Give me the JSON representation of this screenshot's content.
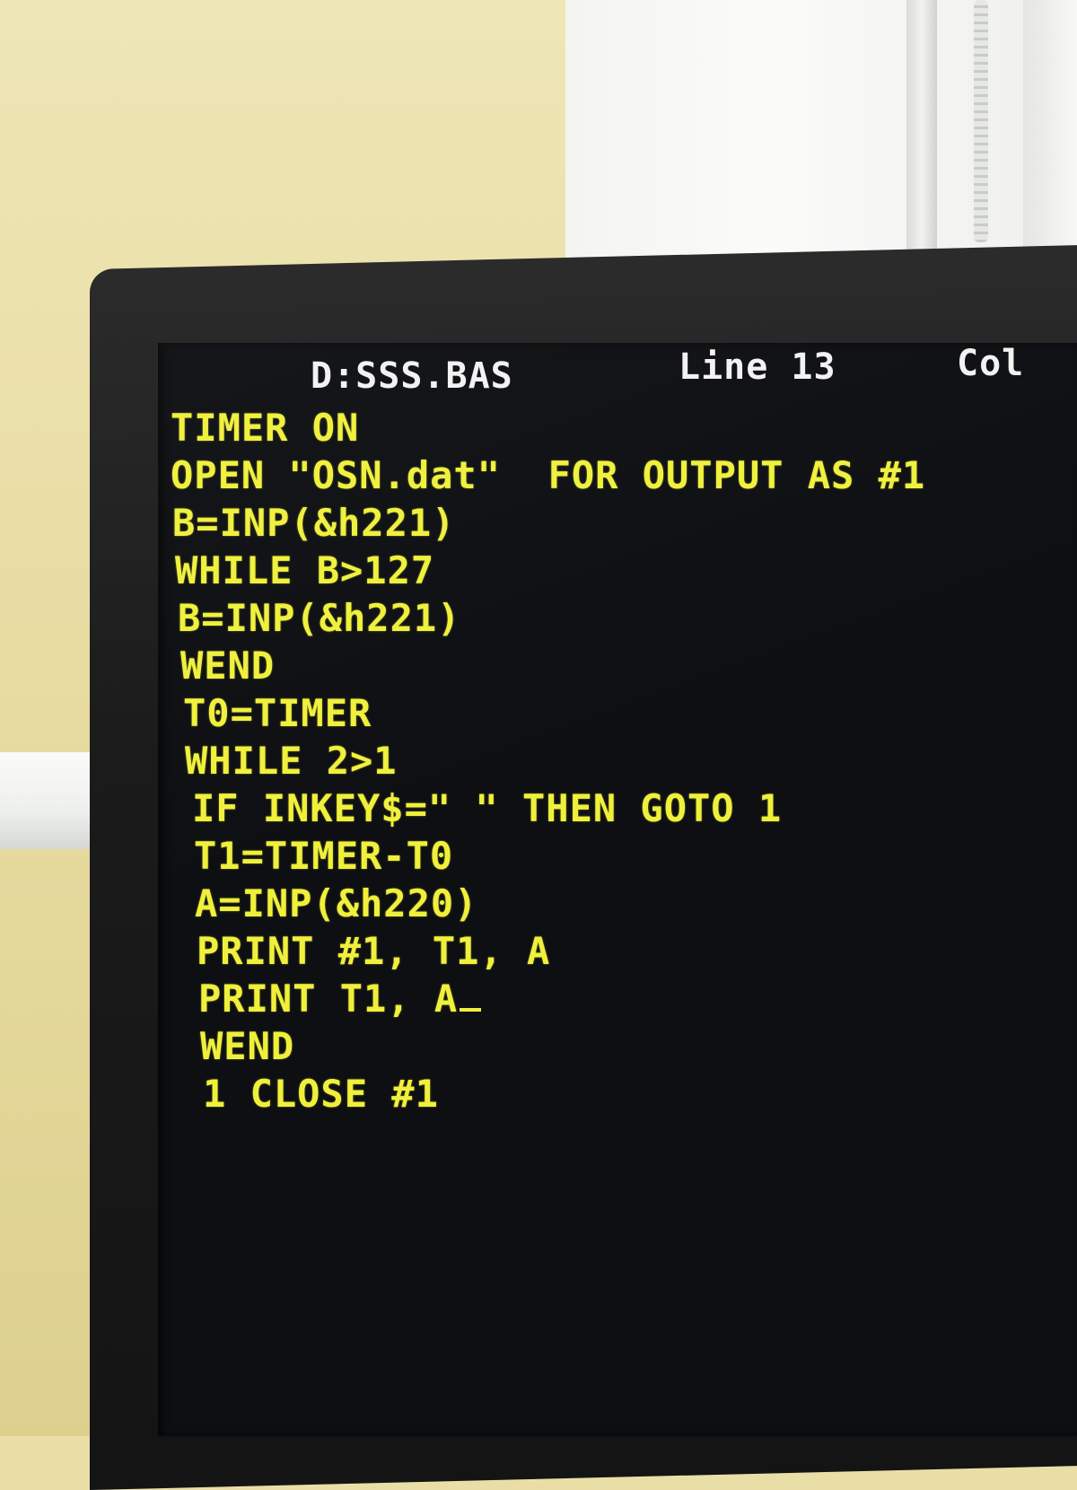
{
  "status_bar": {
    "filename": "D:SSS.BAS",
    "line": "Line 13",
    "col": "Col"
  },
  "code_lines": [
    "TIMER ON",
    "OPEN \"OSN.dat\"  FOR OUTPUT AS #1",
    "B=INP(&h221)",
    "WHILE B>127",
    "B=INP(&h221)",
    "WEND",
    "T0=TIMER",
    "WHILE 2>1",
    "IF INKEY$=\" \" THEN GOTO 1",
    "T1=TIMER-T0",
    "A=INP(&h220)",
    "PRINT #1, T1, A",
    "PRINT T1, A",
    "WEND",
    "1 CLOSE #1"
  ],
  "colors": {
    "code_text": "#f0f03c",
    "status_text": "#f2f2f2",
    "screen_background": "#0d0f12"
  }
}
